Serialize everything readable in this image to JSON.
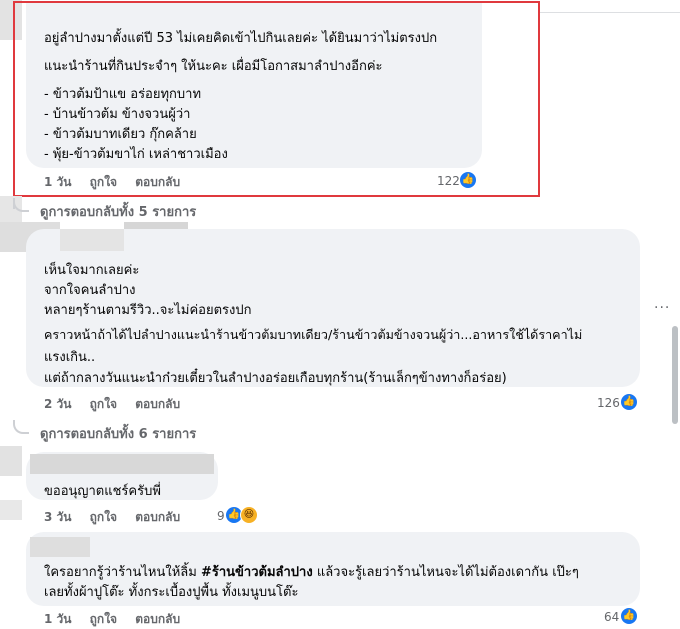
{
  "comments": [
    {
      "lines": [
        "อยู่ลำปางมาตั้งแต่ปี 53 ไม่เคยคิดเข้าไปกินเลยค่ะ ได้ยินมาว่าไม่ตรงปก",
        "แนะนำร้านที่กินประจำๆ ให้นะคะ เผื่อมีโอกาสมาลำปางอีกค่ะ",
        "- ข้าวต้มป้าแข อร่อยทุกบาท",
        "- บ้านข้าวต้ม ข้างจวนผู้ว่า",
        "- ข้าวต้มบาทเดียว กุ๊กคล้าย",
        "- พุ้ย-ข้าวต้มขาไก่ เหล่าชาวเมือง"
      ],
      "time": "1 วัน",
      "like": "ถูกใจ",
      "reply": "ตอบกลับ",
      "reactions": "122",
      "view_replies": "ดูการตอบกลับทั้ง 5 รายการ"
    },
    {
      "lines": [
        "เห็นใจมากเลยค่ะ",
        "จากใจคนลำปาง",
        "หลายๆร้านตามรีวิว..จะไม่ค่อยตรงปก",
        "คราวหน้าถ้าได้ไปลำปางแนะนำร้านข้าวต้มบาทเดียว/ร้านข้าวต้มข้างจวนผู้ว่า...อาหารใช้ได้ราคาไม่",
        "แรงเกิน..",
        "แต่ถ้ากลางวันแนะนำก๋วยเตี๋ยวในลำปางอร่อยเกือบทุกร้าน(ร้านเล็กๆข้างทางก็อร่อย)"
      ],
      "time": "2 วัน",
      "like": "ถูกใจ",
      "reply": "ตอบกลับ",
      "reactions": "126",
      "view_replies": "ดูการตอบกลับทั้ง 6 รายการ"
    },
    {
      "lines": [
        "ขออนุญาตแชร์ครับพี่"
      ],
      "time": "3 วัน",
      "like": "ถูกใจ",
      "reply": "ตอบกลับ",
      "reactions": "9"
    },
    {
      "line_before_tag": "ใครอยากรู้ว่าร้านไหนให้ลิ้ม ",
      "tag": "#ร้านข้าวต้มลำปาง",
      "line_after_tag": " แล้วจะรู้เลยว่าร้านไหนจะได้ไม่ต้องเดากัน เป๊ะๆ",
      "line2": "เลยทั้งผ้าปูโต๊ะ ทั้งกระเบื้องปูพื้น ทั้งเมนูบนโต๊ะ",
      "time": "1 วัน",
      "like": "ถูกใจ",
      "reply": "ตอบกลับ",
      "reactions": "64"
    }
  ],
  "icons": {
    "like": "thumbs-up-icon",
    "haha": "haha-emoji-icon",
    "more": "more-options-icon"
  },
  "colors": {
    "highlight": "#e0393e",
    "like_blue": "#1877f2",
    "bubble": "#f0f2f5",
    "meta": "#65676b"
  }
}
